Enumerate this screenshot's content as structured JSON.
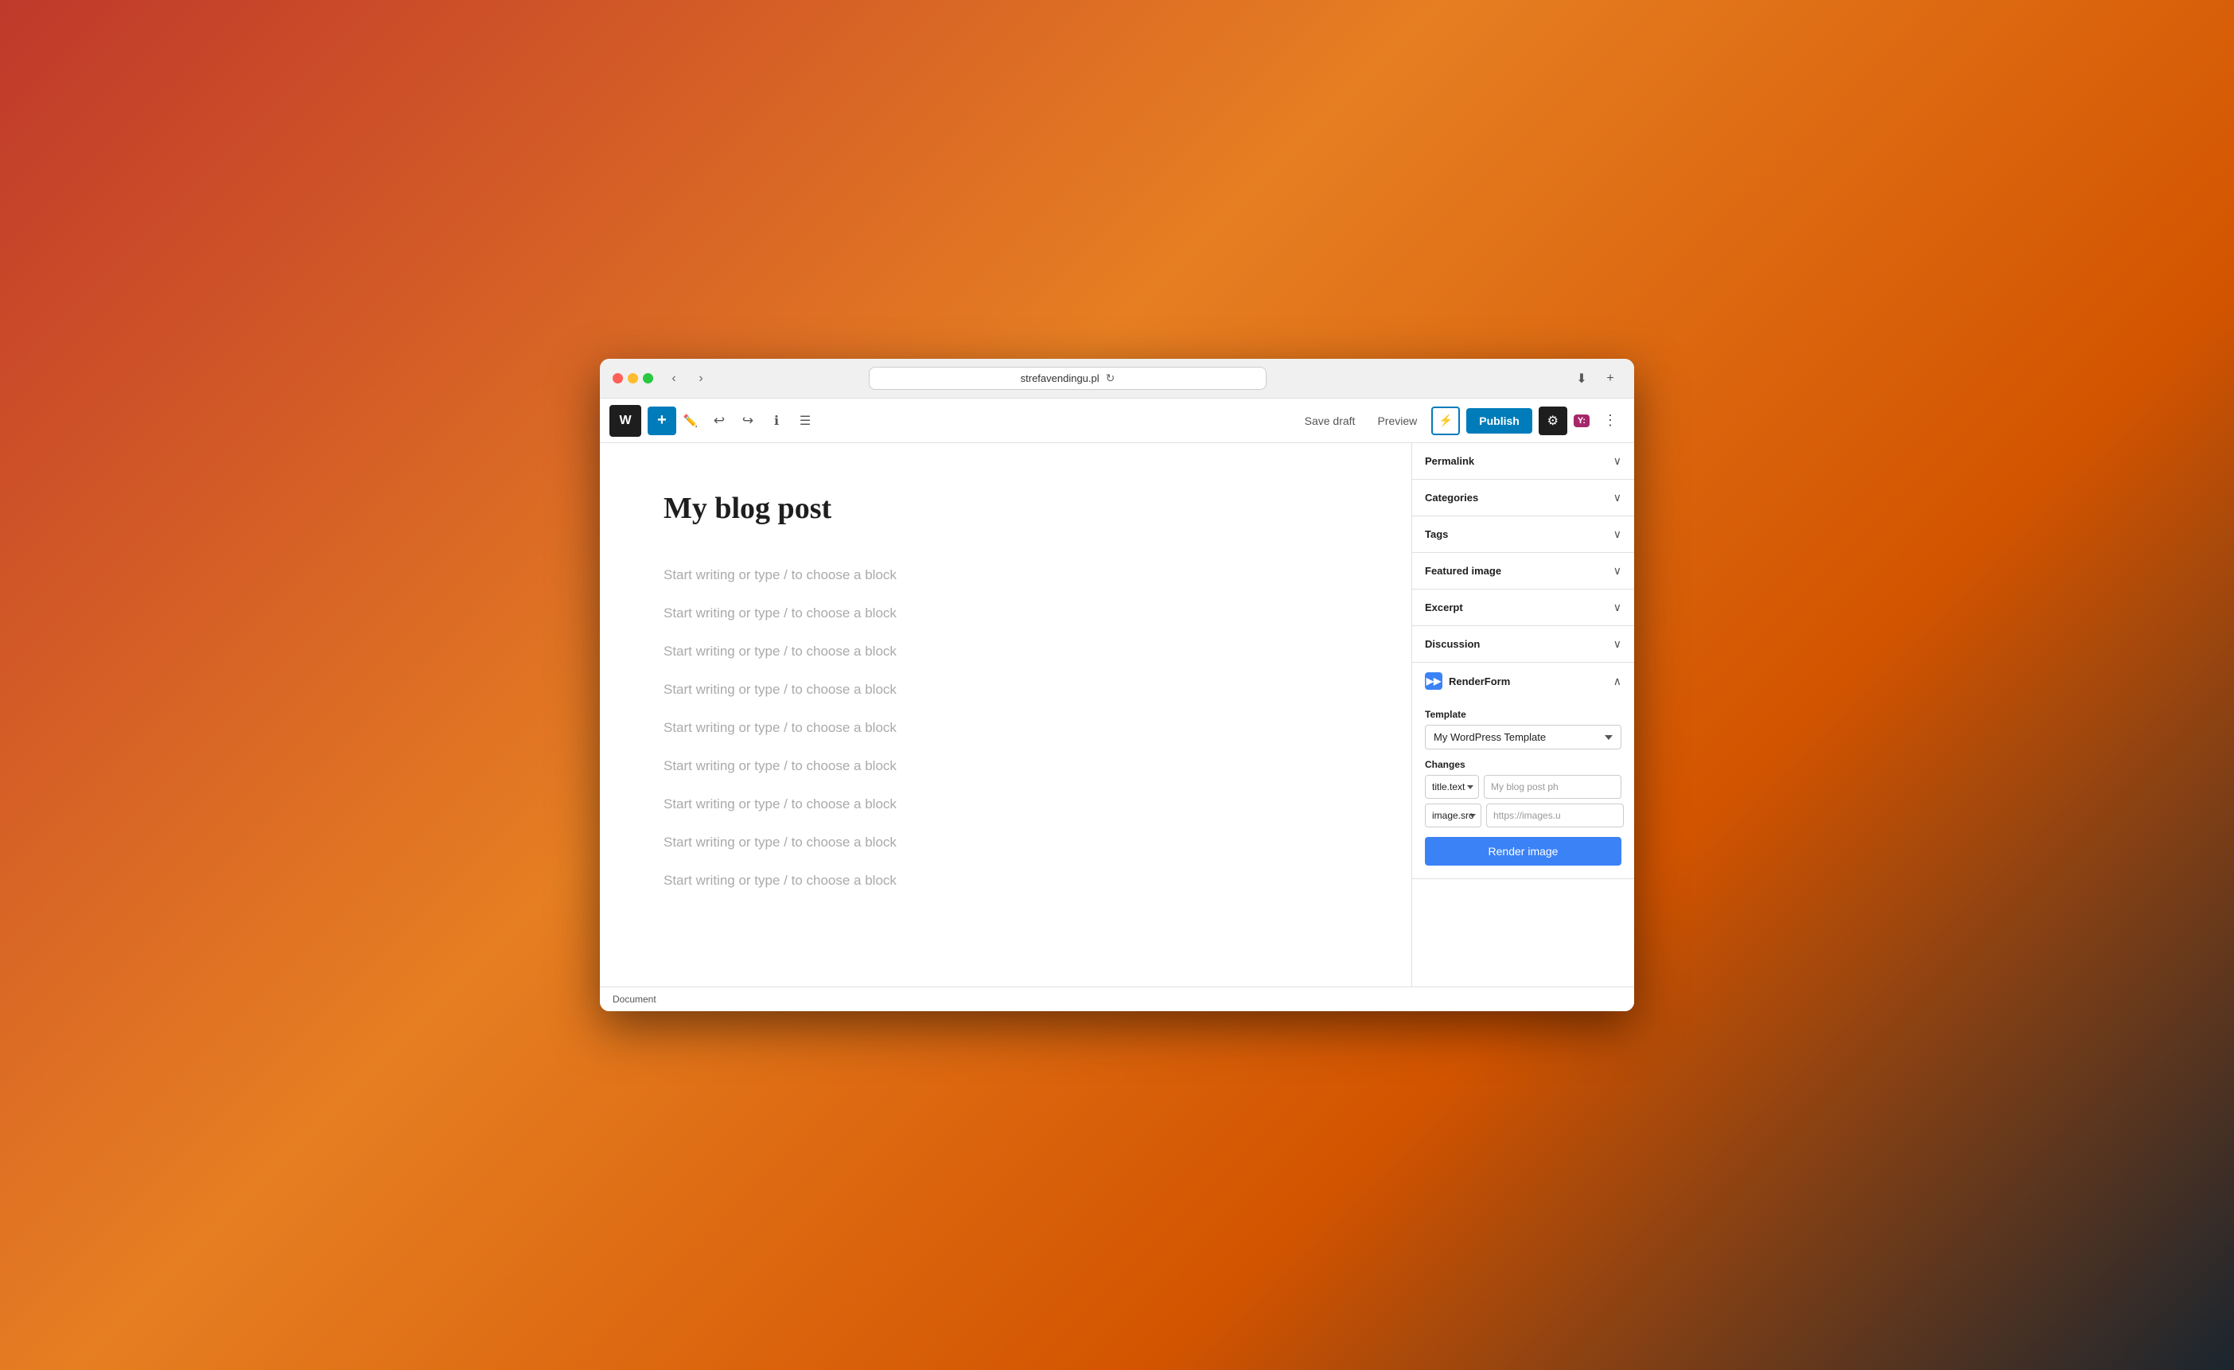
{
  "browser": {
    "url": "strefavendingu.pl",
    "download_icon": "⬇",
    "plus_icon": "+"
  },
  "toolbar": {
    "wp_logo": "W",
    "add_label": "+",
    "pencil_label": "✏",
    "undo_label": "↩",
    "redo_label": "↪",
    "info_label": "ⓘ",
    "list_label": "☰",
    "save_draft_label": "Save draft",
    "preview_label": "Preview",
    "publish_label": "Publish",
    "gear_label": "⚙",
    "yoast_label": "Y",
    "more_label": "⋮"
  },
  "editor": {
    "post_title": "My blog post",
    "blocks": [
      {
        "placeholder": "Start writing or type / to choose a block"
      },
      {
        "placeholder": "Start writing or type / to choose a block"
      },
      {
        "placeholder": "Start writing or type / to choose a block"
      },
      {
        "placeholder": "Start writing or type / to choose a block"
      },
      {
        "placeholder": "Start writing or type / to choose a block"
      },
      {
        "placeholder": "Start writing or type / to choose a block"
      },
      {
        "placeholder": "Start writing or type / to choose a block"
      },
      {
        "placeholder": "Start writing or type / to choose a block"
      },
      {
        "placeholder": "Start writing or type / to choose a block"
      }
    ]
  },
  "sidebar": {
    "sections": [
      {
        "id": "permalink",
        "label": "Permalink"
      },
      {
        "id": "categories",
        "label": "Categories"
      },
      {
        "id": "tags",
        "label": "Tags"
      },
      {
        "id": "featured-image",
        "label": "Featured image"
      },
      {
        "id": "excerpt",
        "label": "Excerpt"
      },
      {
        "id": "discussion",
        "label": "Discussion"
      }
    ],
    "renderform": {
      "title": "RenderForm",
      "icon": "▶▶",
      "template_label": "Template",
      "template_value": "My WordPress Template",
      "template_options": [
        "My WordPress Template"
      ],
      "changes_label": "Changes",
      "change1_key": "title.text",
      "change1_value": "My blog post ph",
      "change2_key": "image.src",
      "change2_value": "https://images.u",
      "render_button_label": "Render image"
    }
  },
  "document_bar": {
    "label": "Document"
  }
}
